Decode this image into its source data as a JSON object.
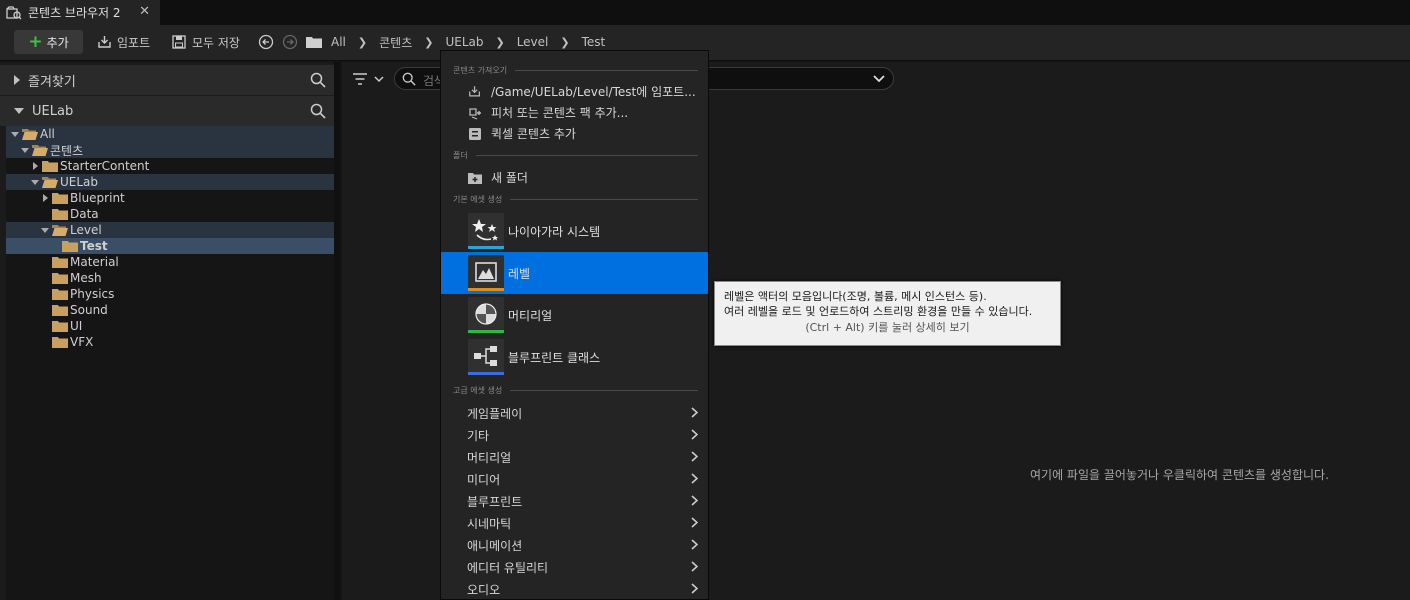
{
  "tab": {
    "title": "콘텐츠 브라우저 2",
    "close": "✕"
  },
  "toolbar": {
    "add_label": "추가",
    "import_label": "임포트",
    "save_all_label": "모두 저장",
    "breadcrumbs": [
      "All",
      "콘텐츠",
      "UELab",
      "Level",
      "Test"
    ]
  },
  "left_panel": {
    "favorites_label": "즐겨찾기",
    "project_label": "UELab",
    "tree": [
      {
        "label": "All",
        "depth": 0,
        "expanded": true,
        "state": "hl"
      },
      {
        "label": "콘텐츠",
        "depth": 1,
        "expanded": true,
        "state": "hl"
      },
      {
        "label": "StarterContent",
        "depth": 2,
        "expanded": false,
        "state": ""
      },
      {
        "label": "UELab",
        "depth": 2,
        "expanded": true,
        "state": "hl"
      },
      {
        "label": "Blueprint",
        "depth": 3,
        "expanded": false,
        "state": ""
      },
      {
        "label": "Data",
        "depth": 3,
        "expanded": null,
        "state": ""
      },
      {
        "label": "Level",
        "depth": 3,
        "expanded": true,
        "state": "hl"
      },
      {
        "label": "Test",
        "depth": 4,
        "expanded": null,
        "state": "sel"
      },
      {
        "label": "Material",
        "depth": 3,
        "expanded": null,
        "state": ""
      },
      {
        "label": "Mesh",
        "depth": 3,
        "expanded": null,
        "state": ""
      },
      {
        "label": "Physics",
        "depth": 3,
        "expanded": null,
        "state": ""
      },
      {
        "label": "Sound",
        "depth": 3,
        "expanded": null,
        "state": ""
      },
      {
        "label": "UI",
        "depth": 3,
        "expanded": null,
        "state": ""
      },
      {
        "label": "VFX",
        "depth": 3,
        "expanded": null,
        "state": ""
      }
    ]
  },
  "main": {
    "search_placeholder": "검색",
    "empty_message": "여기에 파일을 끌어놓거나 우클릭하여 콘텐츠를 생성합니다."
  },
  "menu": {
    "sections": {
      "get_content": "콘텐츠 가져오기",
      "folder": "폴더",
      "basic_assets": "기본 에셋 생성",
      "advanced_assets": "고급 에셋 생성"
    },
    "import_item": "/Game/UELab/Level/Test에 임포트...",
    "feature_pack": "피처 또는 콘텐츠 팩 추가...",
    "quixel": "퀵셀 콘텐츠 추가",
    "new_folder": "새 폴더",
    "basic": [
      {
        "label": "나이아가라 시스템",
        "bar_color": "#2aa6d6",
        "active": false
      },
      {
        "label": "레벨",
        "bar_color": "#d89020",
        "active": true
      },
      {
        "label": "머티리얼",
        "bar_color": "#2fb84a",
        "active": false
      },
      {
        "label": "블루프린트 클래스",
        "bar_color": "#3a6ee0",
        "active": false
      }
    ],
    "advanced": [
      "게임플레이",
      "기타",
      "머티리얼",
      "미디어",
      "블루프린트",
      "시네마틱",
      "애니메이션",
      "에디터 유틸리티",
      "오디오"
    ]
  },
  "tooltip": {
    "line1": "레벨은 액터의 모음입니다(조명, 볼륨, 메시 인스턴스 등).",
    "line2": "여러 레벨을 로드 및 언로드하여 스트리밍 환경을 만들 수 있습니다.",
    "hint": "(Ctrl + Alt) 키를 눌러 상세히 보기"
  },
  "colors": {
    "accent": "#0070e0",
    "add_plus": "#3cc23c",
    "folder": "#c8a060"
  }
}
